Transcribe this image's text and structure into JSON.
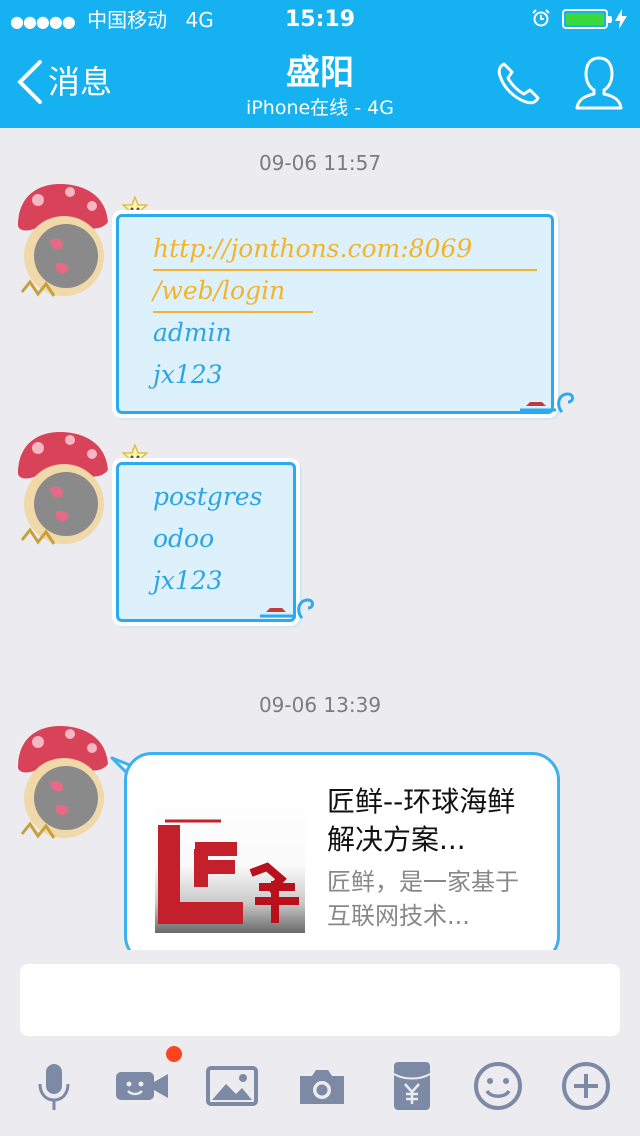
{
  "status_bar": {
    "signal_dots": "●●●●●",
    "carrier": "中国移动",
    "network": "4G",
    "time": "15:19"
  },
  "header": {
    "back_label": "消息",
    "title": "盛阳",
    "subtitle": "iPhone在线 - 4G"
  },
  "messages": [
    {
      "timestamp": "09-06 11:57",
      "lines": [
        "http://jonthons.com:8069",
        "/web/login",
        "admin",
        "jx123"
      ]
    },
    {
      "lines": [
        "postgres",
        "odoo",
        "jx123"
      ]
    },
    {
      "timestamp": "09-06 13:39",
      "card": {
        "title": "匠鲜--环球海鲜解决方案...",
        "description": "匠鲜，是一家基于互联网技术...",
        "image_text": "匠鲜"
      }
    }
  ],
  "toolbar_icons": [
    "microphone-icon",
    "video-icon",
    "image-icon",
    "camera-icon",
    "red-packet-icon",
    "emoji-icon",
    "plus-icon"
  ],
  "colors": {
    "accent": "#16b1f0",
    "bubble_fill": "#dcf1fb",
    "link_text": "#f3b32a",
    "bubble_text": "#2da4e3",
    "notification": "#ff4422"
  }
}
